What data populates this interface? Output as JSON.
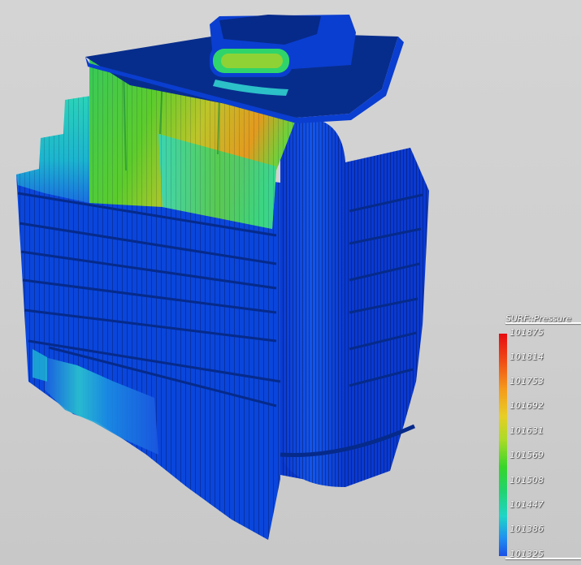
{
  "legend": {
    "title": "SURF::Pressure",
    "ticks": [
      "101875",
      "101814",
      "101753",
      "101692",
      "101631",
      "101569",
      "101508",
      "101447",
      "101386",
      "101325"
    ]
  },
  "colors": {
    "background": "#d0d0d0",
    "building_blue": "#0a3fd6",
    "roof_dark": "#072d8c",
    "high_pressure": "#e80b10",
    "low_pressure": "#1b4fe6"
  }
}
